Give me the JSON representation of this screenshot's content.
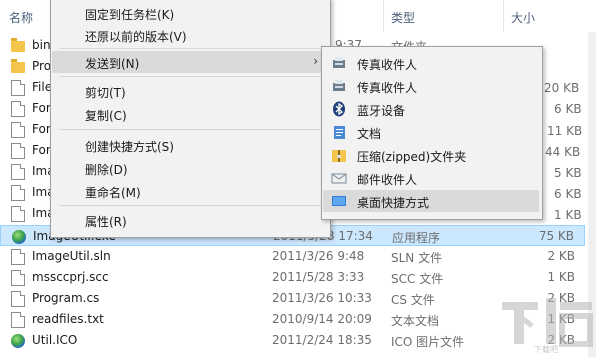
{
  "header": {
    "col_name": "名称",
    "col_type": "类型",
    "col_size": "大小",
    "sort_indicator": "^"
  },
  "rows": [
    {
      "name": "bin",
      "date": "",
      "type": "",
      "size": "",
      "icon": "folder-icon"
    },
    {
      "name": "Pro",
      "date": "",
      "type": "",
      "size": "",
      "icon": "folder-icon"
    },
    {
      "name": "File",
      "date": "",
      "type": "",
      "size": "",
      "icon": "file-icon"
    },
    {
      "name": "For",
      "date": "",
      "type": "",
      "size": "",
      "icon": "file-icon"
    },
    {
      "name": "For",
      "date": "",
      "type": "",
      "size": "",
      "icon": "file-icon"
    },
    {
      "name": "For",
      "date": "",
      "type": "",
      "size": "",
      "icon": "file-icon"
    },
    {
      "name": "Ima",
      "date": "",
      "type": "",
      "size": "",
      "icon": "file-icon"
    },
    {
      "name": "Ima",
      "date": "",
      "type": "",
      "size": "",
      "icon": "file-icon"
    },
    {
      "name": "Ima",
      "date": "",
      "type": "",
      "size": "",
      "icon": "file-icon"
    },
    {
      "name": "ImageUtil.exe",
      "date": "2011/5/28 17:34",
      "type": "应用程序",
      "size": "75 KB",
      "icon": "app-globe-icon"
    },
    {
      "name": "ImageUtil.sln",
      "date": "2011/3/26 9:48",
      "type": "SLN 文件",
      "size": "2 KB",
      "icon": "file-icon"
    },
    {
      "name": "mssccprj.scc",
      "date": "2011/5/28 3:33",
      "type": "SCC 文件",
      "size": "1 KB",
      "icon": "file-icon"
    },
    {
      "name": "Program.cs",
      "date": "2011/3/26 10:33",
      "type": "CS 文件",
      "size": "2 KB",
      "icon": "file-icon"
    },
    {
      "name": "readfiles.txt",
      "date": "2010/9/14 20:09",
      "type": "文本文档",
      "size": "1 KB",
      "icon": "file-icon"
    },
    {
      "name": "Util.ICO",
      "date": "2011/2/24 18:35",
      "type": "ICO 图片文件",
      "size": "2 KB",
      "icon": "app-globe-icon"
    }
  ],
  "partial_cells": {
    "row0_date": "9:37",
    "row0_type": "文件夹",
    "row2_size": "20 KB",
    "row3_size": "6 KB",
    "row4_size": "11 KB",
    "row5_size": "44 KB",
    "row6_size": "5 KB",
    "row7_size": "6 KB",
    "row8_size": "1 KB"
  },
  "context_menu": {
    "pin_taskbar": "固定到任务栏(K)",
    "restore_prev": "还原以前的版本(V)",
    "send_to": "发送到(N)",
    "cut": "剪切(T)",
    "copy": "复制(C)",
    "create_shortcut": "创建快捷方式(S)",
    "delete": "删除(D)",
    "rename": "重命名(M)",
    "properties": "属性(R)",
    "submenu_arrow": "›"
  },
  "send_to_menu": [
    {
      "label": "传真收件人",
      "icon": "fax-icon"
    },
    {
      "label": "传真收件人",
      "icon": "fax-icon"
    },
    {
      "label": "蓝牙设备",
      "icon": "bluetooth-icon"
    },
    {
      "label": "文档",
      "icon": "documents-icon"
    },
    {
      "label": "压缩(zipped)文件夹",
      "icon": "zip-folder-icon"
    },
    {
      "label": "邮件收件人",
      "icon": "mail-icon"
    },
    {
      "label": "桌面快捷方式",
      "icon": "desktop-icon"
    }
  ],
  "watermark": {
    "text": "下载吧"
  },
  "colors": {
    "selection_bg": "#cce8ff",
    "menu_bg": "#f2f2f2",
    "menu_highlight": "#dadada",
    "header_text": "#4c607a"
  }
}
